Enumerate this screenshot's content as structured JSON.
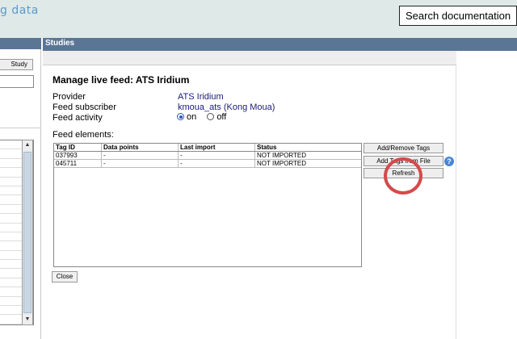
{
  "header": {
    "brand_text": "g data",
    "search_label": "Search documentation"
  },
  "left_panel": {
    "study_button": "Study"
  },
  "studies": {
    "header": "Studies"
  },
  "dialog": {
    "title": "Manage live feed: ATS Iridium",
    "provider_label": "Provider",
    "provider_value": "ATS Iridium",
    "subscriber_label": "Feed subscriber",
    "subscriber_value": "kmoua_ats (Kong Moua)",
    "activity_label": "Feed activity",
    "activity_on": "on",
    "activity_off": "off",
    "activity_selected": "on",
    "elements_label": "Feed elements:",
    "columns": [
      "Tag ID",
      "Data points",
      "Last import",
      "Status"
    ],
    "rows": [
      [
        "037993",
        "-",
        "-",
        "NOT IMPORTED"
      ],
      [
        "045711",
        "-",
        "-",
        "NOT IMPORTED"
      ]
    ],
    "add_remove_tags": "Add/Remove Tags",
    "add_tags_from_file": "Add Tags from File",
    "refresh": "Refresh",
    "close": "Close"
  },
  "colors": {
    "header_bg": "#dfe9e8",
    "panel_header": "#5b7595",
    "brand": "#5a9bc9",
    "highlight_ring": "#d44a4c"
  }
}
